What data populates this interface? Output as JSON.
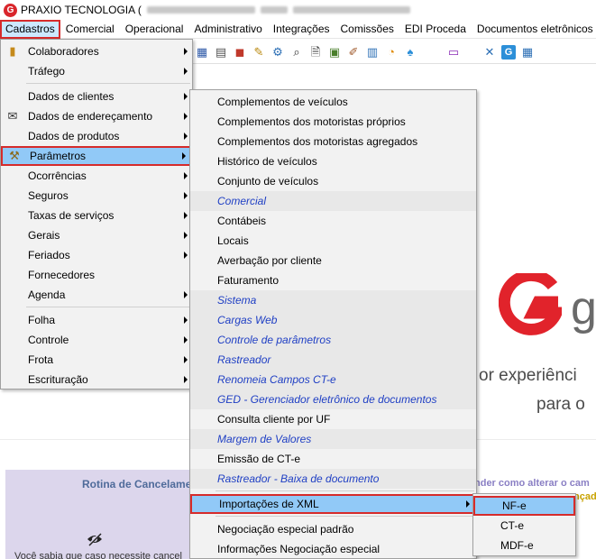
{
  "title": {
    "app_name": "PRAXIO TECNOLOGIA ("
  },
  "menubar": [
    "Cadastros",
    "Comercial",
    "Operacional",
    "Administrativo",
    "Integrações",
    "Comissões",
    "EDI Proceda",
    "Documentos eletrônicos"
  ],
  "cadastros_menu": [
    {
      "label": "Colaboradores",
      "submenu": true,
      "icon": "colaboradores-icon"
    },
    {
      "label": "Tráfego",
      "submenu": true
    },
    {
      "sep": true
    },
    {
      "label": "Dados de clientes",
      "submenu": true
    },
    {
      "label": "Dados de endereçamento",
      "submenu": true,
      "icon": "envelope-icon"
    },
    {
      "label": "Dados de produtos",
      "submenu": true
    },
    {
      "label": "Parâmetros",
      "submenu": true,
      "icon": "parametros-icon",
      "highlighted": true
    },
    {
      "label": "Ocorrências",
      "submenu": true
    },
    {
      "label": "Seguros",
      "submenu": true
    },
    {
      "label": "Taxas de serviços",
      "submenu": true
    },
    {
      "label": "Gerais",
      "submenu": true
    },
    {
      "label": "Feriados",
      "submenu": true
    },
    {
      "label": "Fornecedores",
      "submenu": false
    },
    {
      "label": "Agenda",
      "submenu": true
    },
    {
      "sep": true
    },
    {
      "label": "Folha",
      "submenu": true
    },
    {
      "label": "Controle",
      "submenu": true
    },
    {
      "label": "Frota",
      "submenu": true
    },
    {
      "label": "Escrituração",
      "submenu": true
    }
  ],
  "parametros_menu": [
    {
      "label": "Complementos de veículos"
    },
    {
      "label": "Complementos dos motoristas próprios"
    },
    {
      "label": "Complementos dos motoristas agregados"
    },
    {
      "label": "Histórico de veículos"
    },
    {
      "label": "Conjunto de veículos"
    },
    {
      "label": "Comercial",
      "italic": true
    },
    {
      "label": "Contábeis"
    },
    {
      "label": "Locais"
    },
    {
      "label": "Averbação por cliente"
    },
    {
      "label": "Faturamento"
    },
    {
      "label": "Sistema",
      "italic": true
    },
    {
      "label": "Cargas Web",
      "italic": true
    },
    {
      "label": "Controle de parâmetros",
      "italic": true
    },
    {
      "label": "Rastreador",
      "italic": true
    },
    {
      "label": "Renomeia Campos CT-e",
      "italic": true
    },
    {
      "label": "GED - Gerenciador eletrônico de documentos",
      "italic": true
    },
    {
      "label": "Consulta cliente por UF"
    },
    {
      "label": "Margem de Valores",
      "italic": true
    },
    {
      "label": "Emissão de CT-e"
    },
    {
      "label": "Rastreador - Baixa de documento",
      "italic": true
    },
    {
      "sep": true
    },
    {
      "label": "Importações de XML",
      "submenu": true,
      "highlighted": true
    },
    {
      "sep": true
    },
    {
      "label": "Negociação especial padrão"
    },
    {
      "label": "Informações Negociação especial"
    }
  ],
  "xml_menu": [
    {
      "label": "NF-e",
      "highlighted": true
    },
    {
      "label": "CT-e"
    },
    {
      "label": "MDF-e"
    }
  ],
  "background": {
    "logo_text": "g",
    "line1": "or experiênci",
    "line2": "para o",
    "card_title": "Rotina de Cancelamen",
    "card_text": "Você sabia que caso necessite cancel",
    "right_link": "nder como alterar o cam",
    "right_link2": "nçad"
  },
  "colors": {
    "accent_red": "#d62b2b",
    "highlight_blue": "#91c9f7",
    "italic_link": "#1f3fc4"
  }
}
